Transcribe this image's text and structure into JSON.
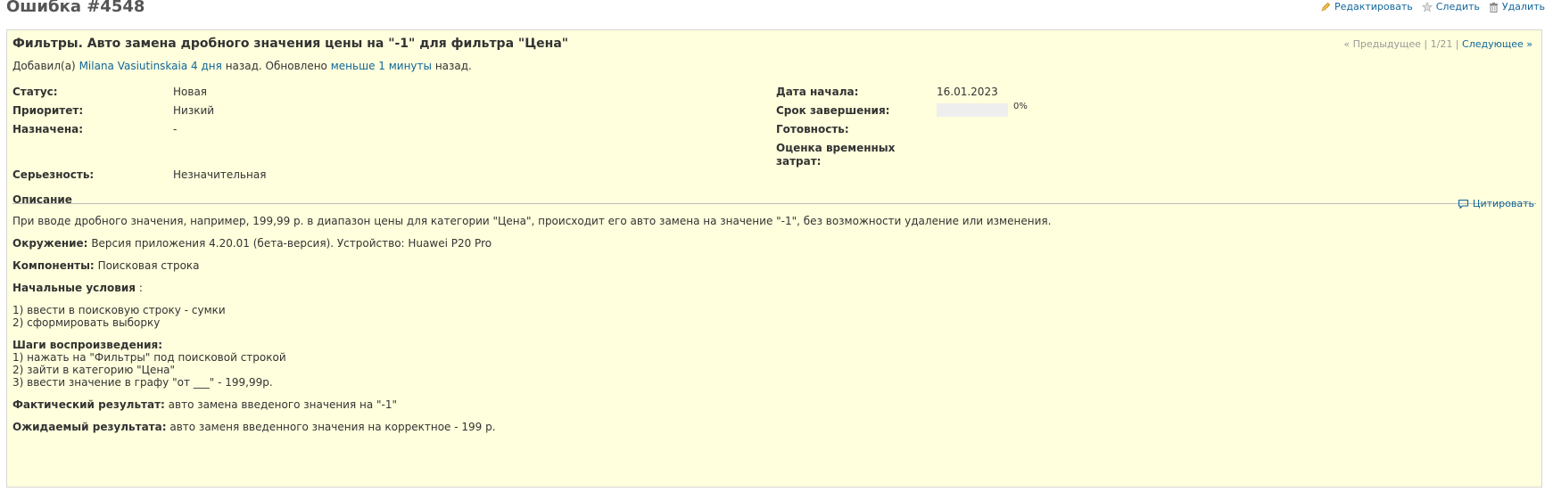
{
  "page_title": "Ошибка #4548",
  "actions": {
    "edit": "Редактировать",
    "watch": "Следить",
    "delete": "Удалить"
  },
  "issue": {
    "subject": "Фильтры. Авто замена дробного значения цены на \"-1\" для фильтра \"Цена\"",
    "author_prefix": "Добавил(а)",
    "author_name": "Milana Vasiutinskaia",
    "created_ago": "4 дня",
    "after_created": "назад. Обновлено",
    "updated_ago": "меньше 1 минуты",
    "after_updated": "назад.",
    "nav": {
      "prev": "« Предыдущее",
      "position": "1/21",
      "next": "Следующее »"
    }
  },
  "attributes": {
    "status_label": "Статус:",
    "status_value": "Новая",
    "priority_label": "Приоритет:",
    "priority_value": "Низкий",
    "assignee_label": "Назначена:",
    "assignee_value": "-",
    "severity_label": "Серьезность:",
    "severity_value": "Незначительная",
    "start_label": "Дата начала:",
    "start_value": "16.01.2023",
    "due_label": "Срок завершения:",
    "done_label": "Готовность:",
    "done_percent": 0,
    "done_text": "0%",
    "estimate_label_line1": "Оценка временных",
    "estimate_label_line2": "затрат:"
  },
  "description": {
    "title": "Описание",
    "quote": "Цитировать",
    "summary": "При вводе дробного значения, например, 199,99 р. в диапазон цены для категории \"Цена\", происходит его авто замена на значение \"-1\", без возможности удаление или изменения.",
    "env_label": "Окружение:",
    "env_value": "Версия приложения 4.20.01 (бета-версия). Устройство: Huawei P20 Pro",
    "components_label": "Компоненты:",
    "components_value": "Поисковая строка",
    "preconditions_label": "Начальные условия",
    "preconditions_colon": ":",
    "preconditions": [
      "1) ввести в поисковую строку - сумки",
      "2) сформировать выборку"
    ],
    "steps_label": "Шаги воспроизведения:",
    "steps": [
      "1) нажать на \"Фильтры\" под поисковой строкой",
      "2) зайти в категорию \"Цена\"",
      "3) ввести значение в графу \"от ___\" - 199,99р."
    ],
    "actual_label": "Фактический результат:",
    "actual_value": "авто замена введеного значения на \"-1\"",
    "expected_label": "Ожидаемый результата:",
    "expected_value": "авто заменя введенного значения на корректное - 199 р."
  }
}
